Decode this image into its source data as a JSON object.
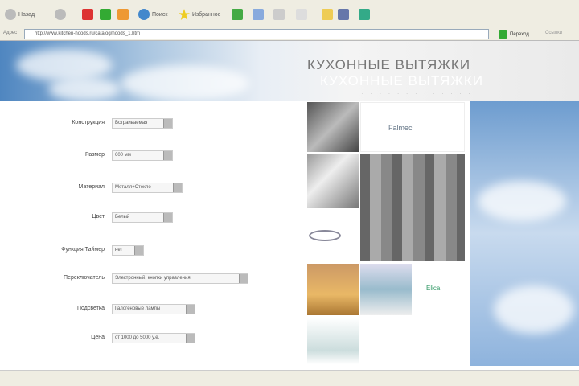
{
  "browser": {
    "back": "Назад",
    "search": "Поиск",
    "favorites": "Избранное",
    "address_label": "Адрес",
    "url": "http://www.kitchen-hoods.ru/catalog/hoods_1.htm",
    "go": "Переход",
    "links": "Ссылки"
  },
  "header": {
    "title": "КУХОННЫЕ ВЫТЯЖКИ",
    "title_shadow": "КУХОННЫЕ ВЫТЯЖКИ",
    "dots": "· · · · · · · · · · · · · · ·"
  },
  "filters": [
    {
      "label": "Конструкция",
      "value": "Встраиваемая"
    },
    {
      "label": "Размер",
      "value": "600 мм"
    },
    {
      "label": "Материал",
      "value": "Металл+Стекло"
    },
    {
      "label": "Цвет",
      "value": "Белый"
    },
    {
      "label": "Функция Таймер",
      "value": "нет"
    },
    {
      "label": "Переключатель",
      "value": "Электронный, кнопки управления"
    },
    {
      "label": "Подсветка",
      "value": "Галогеновые лампы"
    },
    {
      "label": "Цена",
      "value": "от 1000 до 5000 у.е."
    }
  ],
  "brands": {
    "b1": "Falmec",
    "b2": "Elica"
  }
}
